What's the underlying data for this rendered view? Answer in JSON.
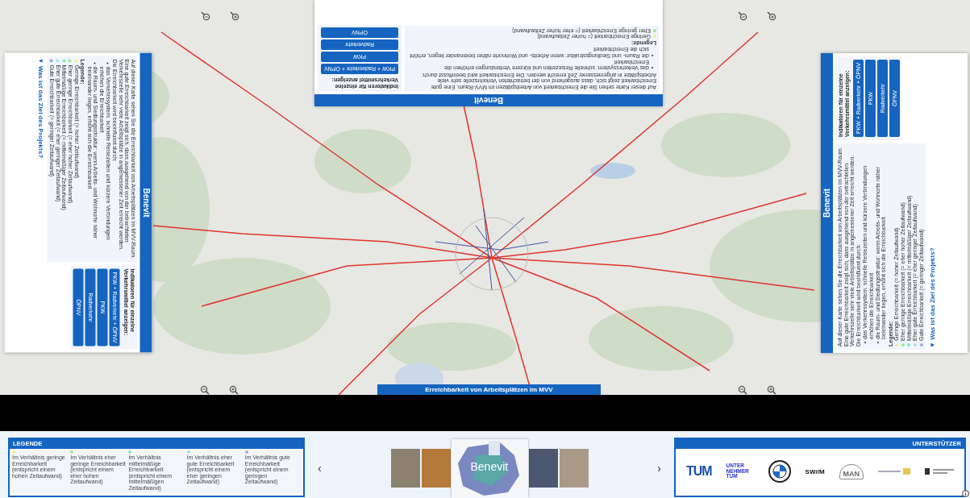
{
  "map": {
    "title": "Erreichbarkeit von Arbeitsplätzen im MVV"
  },
  "panels": [
    {
      "title": "Benevit",
      "intro": "Auf dieser Karte sehen Sie die Erreichbarkeit von Arbeitsplätzen im MVV-Raum. Eine gute Erreichbarkeit zeigt sich, dass ausgehend von der betrachteten Verkehrszelle sehr viele Arbeitsplätze in angemessener Zeit erreicht werden. Die Erreichbarkeit wird beeinflusst durch:",
      "bullets": [
        "das Verkehrssystem: schnelle Reisezeiten und kürzere Verbindungen erhöhen die Erreichbarkeit",
        "die Raum- und Siedlungsstruktur: wenn Arbeits- und Wohnorte näher beieinander liegen, erhöht sich die Erreichbarkeit"
      ],
      "legend_title": "Legende:",
      "legend": [
        {
          "label": "Geringe Erreichbarkeit (= hoher Zeitaufwand)",
          "color": "#f2ee9a"
        },
        {
          "label": "Eher geringe Erreichbarkeit (= eher hoher Zeitaufwand)",
          "color": "#9ee89a"
        }
      ],
      "indicators_title": "Indikatoren für einzelne Verkehrsmittel anzeigen:",
      "modes": [
        "PKW + Radverkehr + ÖPNV",
        "PKW",
        "Radverkehr",
        "ÖPNV"
      ]
    },
    {
      "title": "Benevit",
      "intro": "Auf dieser Karte sehen Sie die Erreichbarkeit von Arbeitsplätzen im MVV-Raum. Eine gute Erreichbarkeit zeigt sich, dass ausgehend von der betrachteten Verkehrszelle sehr viele Arbeitsplätze in angemessener Zeit erreicht werden. Die Erreichbarkeit wird beeinflusst durch:",
      "bullets": [
        "das Verkehrssystem: schnelle Reisezeiten und kürzere Verbindungen erhöhen die Erreichbarkeit",
        "die Raum- und Siedlungsstruktur: wenn Arbeits- und Wohnorte näher beieinander liegen, erhöht sich die Erreichbarkeit"
      ],
      "legend_title": "Legende:",
      "legend": [
        {
          "label": "Geringe Erreichbarkeit (= hoher Zeitaufwand)",
          "color": "#f2ee9a"
        },
        {
          "label": "Eher geringe Erreichbarkeit (= eher hoher Zeitaufwand)",
          "color": "#9ee89a"
        },
        {
          "label": "Mittelmäßige Erreichbarkeit (= mittelmäßiger Zeitaufwand)",
          "color": "#86e6c4"
        },
        {
          "label": "Eher gute Erreichbarkeit (= eher geringer Zeitaufwand)",
          "color": "#9ae8ec"
        },
        {
          "label": "Gute Erreichbarkeit (= geringer Zeitaufwand)",
          "color": "#aaa2ea"
        }
      ],
      "indicators_title": "Indikatoren für einzelne Verkehrsmittel anzeigen:",
      "modes": [
        "PKW + Radverkehr + ÖPNV",
        "PKW",
        "Radverkehr",
        "ÖPNV"
      ],
      "link": "▼ Was ist das Ziel des Projekts?"
    },
    {
      "title": "Benevit",
      "intro": "Auf dieser Karte sehen Sie die Erreichbarkeit von Arbeitsplätzen im MVV-Raum. Eine gute Erreichbarkeit zeigt sich, dass ausgehend von der betrachteten Verkehrszelle sehr viele Arbeitsplätze in angemessener Zeit erreicht werden. Die Erreichbarkeit wird beeinflusst durch:",
      "bullets": [
        "das Verkehrssystem: schnelle Reisezeiten und kürzere Verbindungen erhöhen die Erreichbarkeit",
        "die Raum- und Siedlungsstruktur: wenn Arbeits- und Wohnorte näher beieinander liegen, erhöht sich die Erreichbarkeit"
      ],
      "legend_title": "Legende:",
      "legend": [
        {
          "label": "Geringe Erreichbarkeit (= hoher Zeitaufwand)",
          "color": "#f2ee9a"
        },
        {
          "label": "Eher geringe Erreichbarkeit (= eher hoher Zeitaufwand)",
          "color": "#9ee89a"
        },
        {
          "label": "Mittelmäßige Erreichbarkeit (= mittelmäßiger Zeitaufwand)",
          "color": "#86e6c4"
        },
        {
          "label": "Eher gute Erreichbarkeit (= eher geringer Zeitaufwand)",
          "color": "#9ae8ec"
        },
        {
          "label": "Gute Erreichbarkeit (= geringer Zeitaufwand)",
          "color": "#aaa2ea"
        }
      ],
      "indicators_title": "Indikatoren für einzelne Verkehrsmittel anzeigen:",
      "modes": [
        "PKW + Radverkehr + ÖPNV",
        "PKW",
        "Radverkehr",
        "ÖPNV"
      ],
      "link": "▼ Was ist das Ziel des Projekts?"
    }
  ],
  "legend": {
    "title": "LEGENDE",
    "items": [
      {
        "label": "Im Verhältnis geringe Erreichbarkeit (entspricht einem hohen Zeitaufwand)",
        "color": "#f2ee9a"
      },
      {
        "label": "Im Verhältnis eher geringe Erreichbarkeit (entspricht einem eher hohen Zeitaufwand)",
        "color": "#9ee89a"
      },
      {
        "label": "Im Verhältnis mittelmäßige Erreichbarkeit (entspricht einem mittelmäßigen Zeitaufwand)",
        "color": "#86e6c4"
      },
      {
        "label": "Im Verhältnis eher gute Erreichbarkeit (entspricht einem eher geringen Zeitaufwand)",
        "color": "#9ae8ec"
      },
      {
        "label": "Im Verhältnis gute Erreichbarkeit (entspricht einem geringen Zeitaufwand)",
        "color": "#aaa2ea"
      }
    ]
  },
  "carousel": {
    "prev": "‹",
    "next": "›",
    "items": [
      {
        "selected": false
      },
      {
        "selected": false
      },
      {
        "selected": true,
        "label": "Benevit"
      },
      {
        "selected": false
      },
      {
        "selected": false
      }
    ]
  },
  "supporters": {
    "title": "UNTERSTÜTZER",
    "logos": [
      {
        "kind": "tum",
        "text": "TUM"
      },
      {
        "kind": "wordmark",
        "text": "UNTER NEHMER TUM"
      },
      {
        "kind": "roundel"
      },
      {
        "kind": "swm",
        "text": "SW//M"
      },
      {
        "kind": "man",
        "text": "MAN"
      },
      {
        "kind": "seal"
      },
      {
        "kind": "crest"
      }
    ]
  }
}
